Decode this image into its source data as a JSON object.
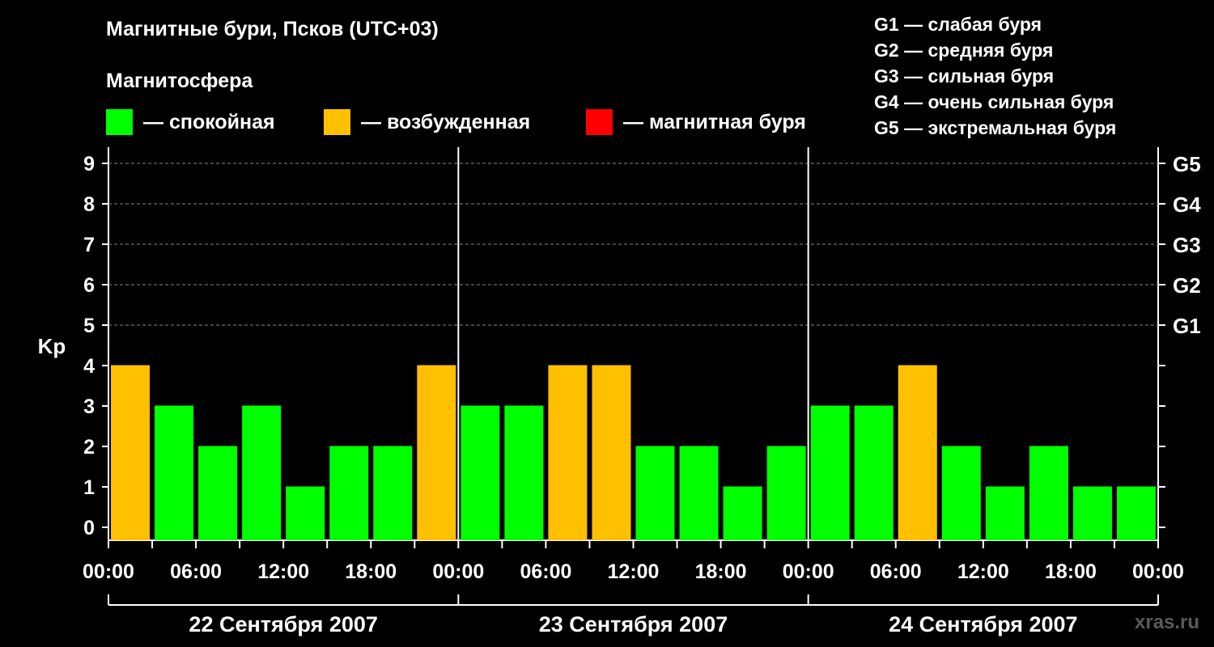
{
  "title": "Магнитные бури, Псков (UTC+03)",
  "subtitle": "Магнитосфера",
  "legend": [
    {
      "label": "— спокойная",
      "color": "#00ff00"
    },
    {
      "label": "— возбужденная",
      "color": "#ffc000"
    },
    {
      "label": "— магнитная буря",
      "color": "#ff0000"
    }
  ],
  "storm_scale": [
    "G1 — слабая буря",
    "G2 — средняя буря",
    "G3 — сильная буря",
    "G4 — очень сильная буря",
    "G5 — экстремальная буря"
  ],
  "watermark": "xras.ru",
  "colors": {
    "calm": "#00ff00",
    "disturbed": "#ffc000",
    "storm": "#ff0000",
    "background": "#000000",
    "grid": "#888888"
  },
  "chart_data": {
    "type": "bar",
    "ylabel": "Kp",
    "ylim": [
      0,
      9
    ],
    "y_ticks": [
      0,
      1,
      2,
      3,
      4,
      5,
      6,
      7,
      8,
      9
    ],
    "right_ticks": [
      {
        "value": 5,
        "label": "G1"
      },
      {
        "value": 6,
        "label": "G2"
      },
      {
        "value": 7,
        "label": "G3"
      },
      {
        "value": 8,
        "label": "G4"
      },
      {
        "value": 9,
        "label": "G5"
      }
    ],
    "x_tick_labels": [
      "00:00",
      "06:00",
      "12:00",
      "18:00",
      "00:00",
      "06:00",
      "12:00",
      "18:00",
      "00:00",
      "06:00",
      "12:00",
      "18:00",
      "00:00"
    ],
    "days": [
      "22 Сентября 2007",
      "23 Сентября 2007",
      "24 Сентября 2007"
    ],
    "interval_hours": 3,
    "values": [
      4,
      3,
      2,
      3,
      1,
      2,
      2,
      4,
      3,
      3,
      4,
      4,
      2,
      2,
      1,
      2,
      3,
      3,
      4,
      2,
      1,
      2,
      1,
      1
    ],
    "grid": "dashed horizontal at integer Kp",
    "thresholds": {
      "calm_below": 4,
      "disturbed": 4,
      "storm_from": 5
    }
  }
}
